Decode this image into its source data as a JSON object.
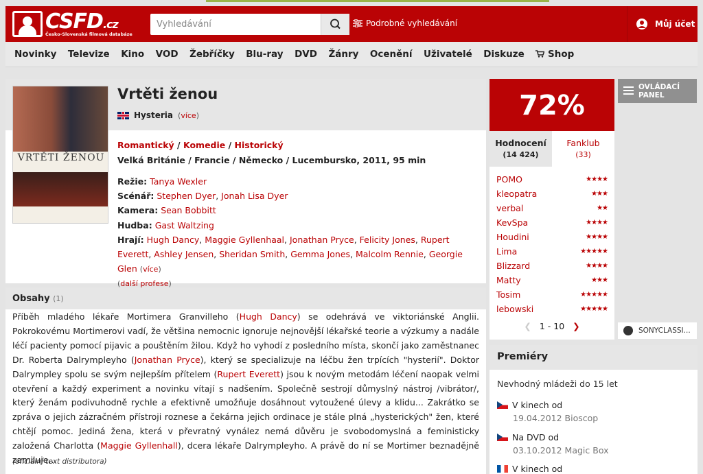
{
  "header": {
    "logo_text": "CSFD",
    "logo_suffix": ".cz",
    "logo_subtitle": "Česko-Slovenská filmová databáze",
    "search_placeholder": "Vyhledávání",
    "advanced_search": "Podrobné vyhledávání",
    "account": "Můj účet"
  },
  "nav": [
    "Novinky",
    "Televize",
    "Kino",
    "VOD",
    "Žebříčky",
    "Blu-ray",
    "DVD",
    "Žánry",
    "Ocenění",
    "Uživatelé",
    "Diskuze",
    "Shop"
  ],
  "film": {
    "title": "Vrtěti ženou",
    "original_title": "Hysteria",
    "original_more": "(více)",
    "genres": [
      "Romantický",
      "Komedie",
      "Historický"
    ],
    "origin": "Velká Británie / Francie / Německo / Lucembursko, 2011, 95 min",
    "poster_title": "VRTĚTI ŽENOU",
    "director_label": "Režie:",
    "director": "Tanya Wexler",
    "writers_label": "Scénář:",
    "writers": [
      "Stephen Dyer",
      "Jonah Lisa Dyer"
    ],
    "camera_label": "Kamera:",
    "camera": "Sean Bobbitt",
    "music_label": "Hudba:",
    "music": "Gast Waltzing",
    "cast_label": "Hrají:",
    "cast": [
      "Hugh Dancy",
      "Maggie Gyllenhaal",
      "Jonathan Pryce",
      "Felicity Jones",
      "Rupert Everett",
      "Ashley Jensen",
      "Sheridan Smith",
      "Gemma Jones",
      "Malcolm Rennie",
      "Georgie Glen"
    ],
    "cast_more": "(více)",
    "more_professions": "další profese"
  },
  "plot": {
    "heading": "Obsahy",
    "count": "(1)",
    "text_parts": [
      "Příběh mladého lékaře Mortimera Granvilleho (",
      "Hugh Dancy",
      ") se odehrává ve viktoriánské Anglii. Pokrokovému Mortimerovi vadí, že většina nemocnic ignoruje nejnovější lékařské teorie a výzkumy a nadále léčí pacienty pomocí pijavic a pouštěním žilou. Když ho vyhodí z posledního místa, skončí jako zaměstnanec Dr. Roberta Dalrympleyho (",
      "Jonathan Pryce",
      "), který se specializuje na léčbu žen trpících \"hysterií\". Doktor Dalrympley spolu se svým nejlepším přítelem (",
      "Rupert Everett",
      ") jsou k novým metodám léčení naopak velmi otevření a každý experiment a novinku vítají s nadšením. Společně sestrojí důmyslný nástroj /vibrátor/, který ženám podivuhodně rychle a efektivně umožňuje dosáhnout vytoužené úlevy a klidu... Zakrátko se zpráva o jejich zázračném přístroji roznese a čekárna jejich ordinace je stále plná „hysterických\" žen, které chtějí pomoc. Jediná žena, která v převratný vynález nemá důvěru je svobodomyslná a feministicky založená Charlotta (",
      "Maggie Gyllenhall",
      "), dcera lékaře Dalrympleyho. A právě do ní se Mortimer beznadějně zamiluje..."
    ],
    "source": "(oficiální text distributora)"
  },
  "rating": {
    "score": "72%",
    "tab_ratings": "Hodnocení",
    "tab_ratings_count": "(14 424)",
    "tab_fanclub": "Fanklub",
    "tab_fanclub_count": "(33)",
    "users": [
      {
        "name": "POMO",
        "stars": 4
      },
      {
        "name": "kleopatra",
        "stars": 3
      },
      {
        "name": "verbal",
        "stars": 2
      },
      {
        "name": "KevSpa",
        "stars": 4
      },
      {
        "name": "Houdini",
        "stars": 4
      },
      {
        "name": "Lima",
        "stars": 5
      },
      {
        "name": "Blizzard",
        "stars": 4
      },
      {
        "name": "Matty",
        "stars": 3
      },
      {
        "name": "Tosim",
        "stars": 5
      },
      {
        "name": "lebowski",
        "stars": 5
      }
    ],
    "pager": "1 - 10"
  },
  "side": {
    "panel_button": "OVLÁDACÍ PANEL",
    "sony": "SONYCLASSI..."
  },
  "premieres": {
    "heading": "Premiéry",
    "age": "Nevhodný mládeži do 15 let",
    "items": [
      {
        "label": "V kinech od",
        "detail": "19.04.2012 Bioscop",
        "flag": "cz"
      },
      {
        "label": "Na DVD od",
        "detail": "03.10.2012 Magic Box",
        "flag": "cz"
      },
      {
        "label": "V kinech od",
        "detail": "",
        "flag": "fr"
      }
    ]
  },
  "colors": {
    "accent": "#ba0305",
    "background": "#e4e4e4"
  }
}
